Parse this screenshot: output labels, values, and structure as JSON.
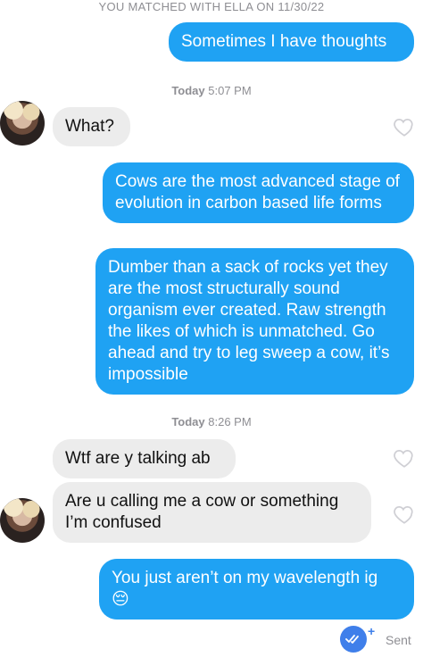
{
  "header": {
    "match_text": "YOU MATCHED WITH ELLA ON 11/30/22"
  },
  "timestamps": [
    {
      "day": "Today",
      "time": "5:07 PM"
    },
    {
      "day": "Today",
      "time": "8:26 PM"
    }
  ],
  "messages": [
    {
      "from": "me",
      "text": "Sometimes I have thoughts"
    },
    {
      "from": "them",
      "text": "What?"
    },
    {
      "from": "me",
      "text": "Cows are the most advanced stage of evolution in carbon based life forms"
    },
    {
      "from": "me",
      "text": "Dumber than a sack of rocks yet they are the most structurally sound organism ever created. Raw strength the likes of which is unmatched. Go ahead and try to leg sweep a cow, it’s impossible"
    },
    {
      "from": "them",
      "text": "Wtf are y talking ab"
    },
    {
      "from": "them",
      "text": "Are u calling me a cow or something I’m confused"
    },
    {
      "from": "me",
      "text": "You just aren’t on my wavelength ig",
      "emoji": "😔"
    }
  ],
  "status": {
    "sent_label": "Sent",
    "plus": "+"
  },
  "colors": {
    "outgoing": "#1fa2f3",
    "incoming": "#ececec",
    "read_badge": "#3f7fea"
  },
  "icons": {
    "like": "heart-outline-icon",
    "read": "double-check-icon"
  }
}
